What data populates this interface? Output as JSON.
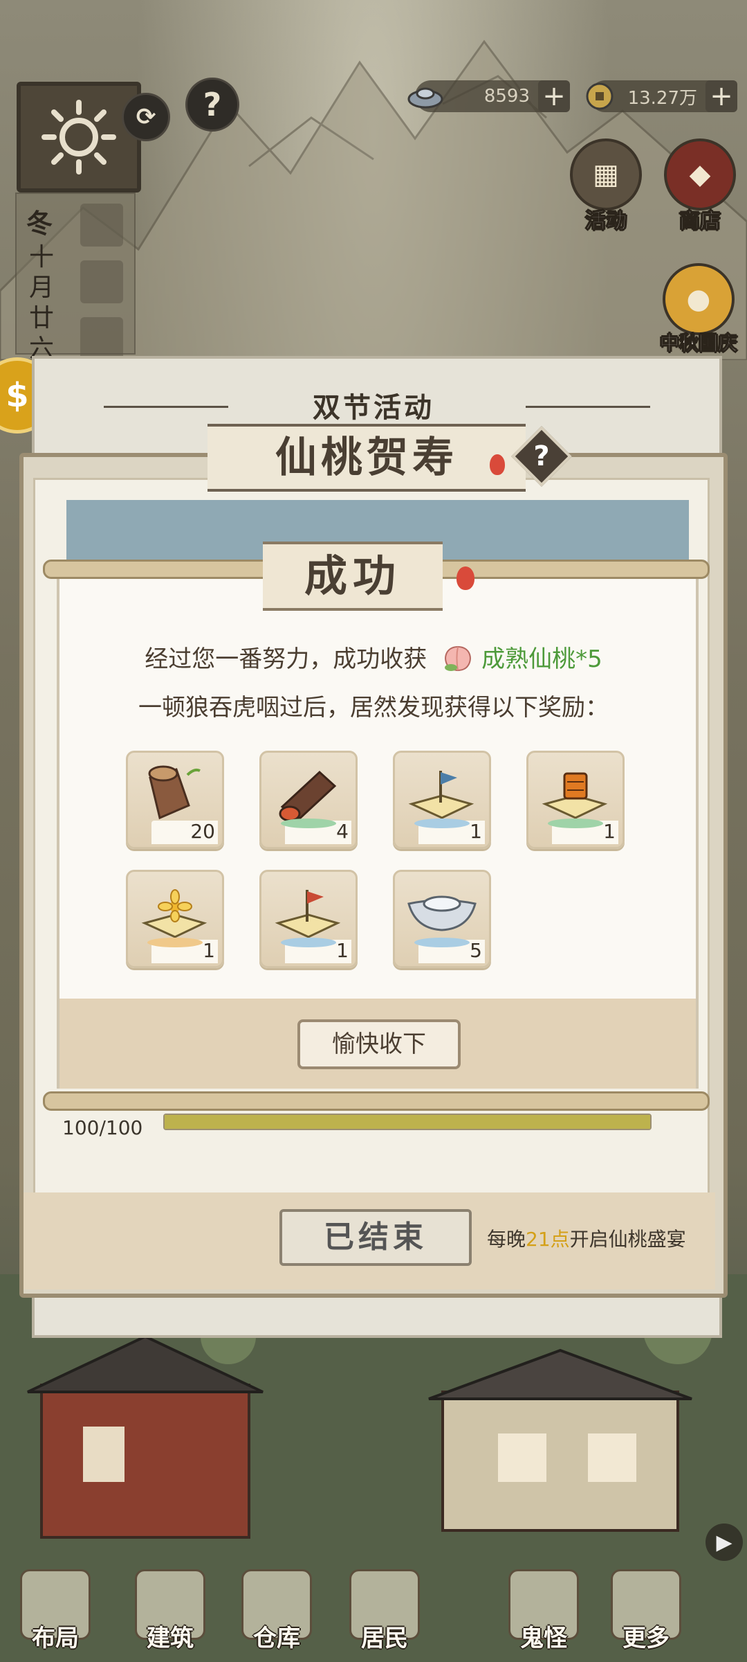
{
  "hud": {
    "ingot_count": "8593",
    "coin_count": "13.27万",
    "plus": "+",
    "help": "?"
  },
  "calendar": {
    "season": "冬",
    "date": "十月廿六"
  },
  "side_icons": {
    "activity": "活动",
    "shop": "商店",
    "festival": "中秋国庆"
  },
  "panel": {
    "header": "双节活动",
    "title": "仙桃贺寿",
    "progress": "100/100",
    "progress_fraction": 1.0,
    "ended_button": "已结束",
    "note_prefix": "每晚",
    "note_time": "21点",
    "note_suffix": "开启仙桃盛宴"
  },
  "modal": {
    "title": "成功",
    "line1_prefix": "经过您一番努力，成功收获",
    "line1_item": "成熟仙桃*5",
    "line2": "一顿狼吞虎咽过后，居然发现获得以下奖励：",
    "confirm": "愉快收下",
    "rewards": [
      {
        "icon": "wood-stump-icon",
        "count": "20"
      },
      {
        "icon": "log-icon",
        "count": "4"
      },
      {
        "icon": "blue-flag-token-icon",
        "count": "1"
      },
      {
        "icon": "lantern-token-icon",
        "count": "1"
      },
      {
        "icon": "flower-token-icon",
        "count": "1"
      },
      {
        "icon": "red-flag-token-icon",
        "count": "1"
      },
      {
        "icon": "silver-ingot-icon",
        "count": "5"
      }
    ]
  },
  "nav": {
    "items": [
      "布局",
      "建筑",
      "仓库",
      "居民",
      "鬼怪",
      "更多"
    ],
    "arrow": "▶"
  }
}
